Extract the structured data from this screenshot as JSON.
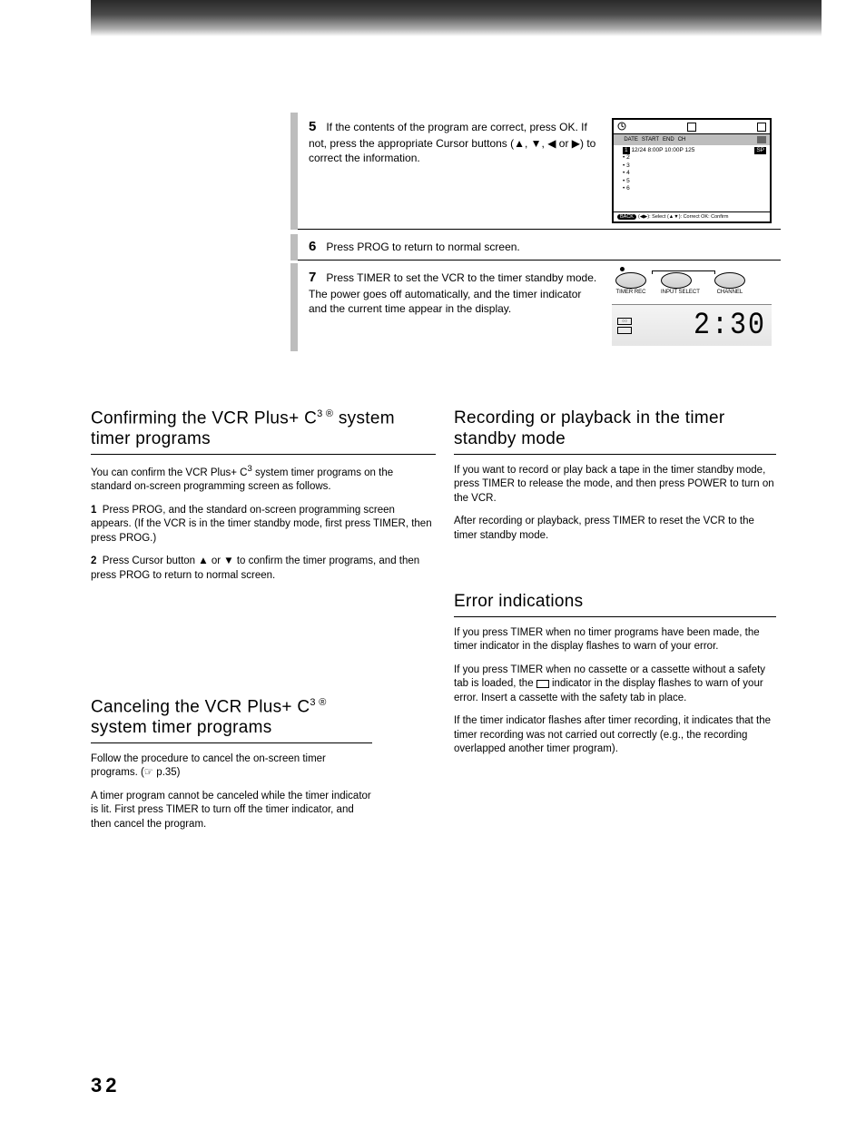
{
  "page_number": "32",
  "steps": {
    "s5": {
      "num": "5",
      "text": "If the contents of the program are correct, press OK. If not, press the appropriate Cursor buttons (▲, ▼, ◀ or ▶) to correct the information.",
      "osd": {
        "header_cols": [
          "DATE",
          "START",
          "END",
          "CH"
        ],
        "row_highlight": "1",
        "row1": "12/24  8:00P 10:00P 125",
        "row_sp_label": "SP",
        "empty_rows": [
          "2",
          "3",
          "4",
          "5",
          "6"
        ],
        "footer_back": "BACK",
        "footer_hint": "(◀▶): Select   (▲▼): Correct   OK: Confirm"
      }
    },
    "s6": {
      "num": "6",
      "text": "Press PROG to return to normal screen."
    },
    "s7": {
      "num": "7",
      "text": "Press TIMER to set the VCR to the timer standby mode. The power goes off automatically, and the timer indicator and the current time appear in the display.",
      "vcr": {
        "btn_left_label": "TIMER REC",
        "btn_mid_label": "INPUT SELECT",
        "btn_right_label": "CHANNEL",
        "disp_icon_top": "○○",
        "disp_time": "2:30"
      }
    }
  },
  "sections": {
    "confirm": {
      "title_pre": "Confirming the VCR Plus+ C",
      "title_sup": "3 ®",
      "title_post": " system timer programs",
      "para1_pre": "You can confirm the VCR Plus+ C",
      "para1_sup": "3",
      "para1_post": " system timer programs on the standard on-screen programming screen as follows.",
      "step1_num": "1",
      "step1": "Press PROG, and the standard on-screen programming screen appears. (If the VCR is in the timer standby mode, first press TIMER, then press PROG.)",
      "step2_num": "2",
      "step2": "Press Cursor button ▲ or ▼ to confirm the timer programs, and then press PROG to return to normal screen."
    },
    "cancel": {
      "title_pre": "Canceling the VCR Plus+ C",
      "title_sup": "3 ®",
      "title_post": " system timer programs",
      "p1_a": "Follow the procedure to cancel the on-screen timer programs. (☞ p.35)",
      "p2_a": "A timer program cannot be canceled while the timer indicator is lit. First press TIMER to turn off the timer indicator, and then cancel the program."
    },
    "recplay": {
      "title": "Recording or playback in the timer standby mode",
      "p1": "If you want to record or play back a tape in the timer standby mode, press TIMER to release the mode, and then press POWER to turn on the VCR.",
      "p2": "After recording or playback, press TIMER to reset the VCR to the timer standby mode."
    },
    "errors": {
      "title": "Error indications",
      "e1": "If you press TIMER when no timer programs have been made, the timer indicator in the display flashes to warn of your error.",
      "e2_a": "If you press TIMER when no cassette or a cassette without a safety tab is loaded, the ",
      "e2_b": " indicator in the display flashes to warn of your error. Insert a cassette with the safety tab in place.",
      "e3": "If the timer indicator flashes after timer recording, it indicates that the timer recording was not carried out correctly (e.g., the recording overlapped another timer program)."
    }
  }
}
